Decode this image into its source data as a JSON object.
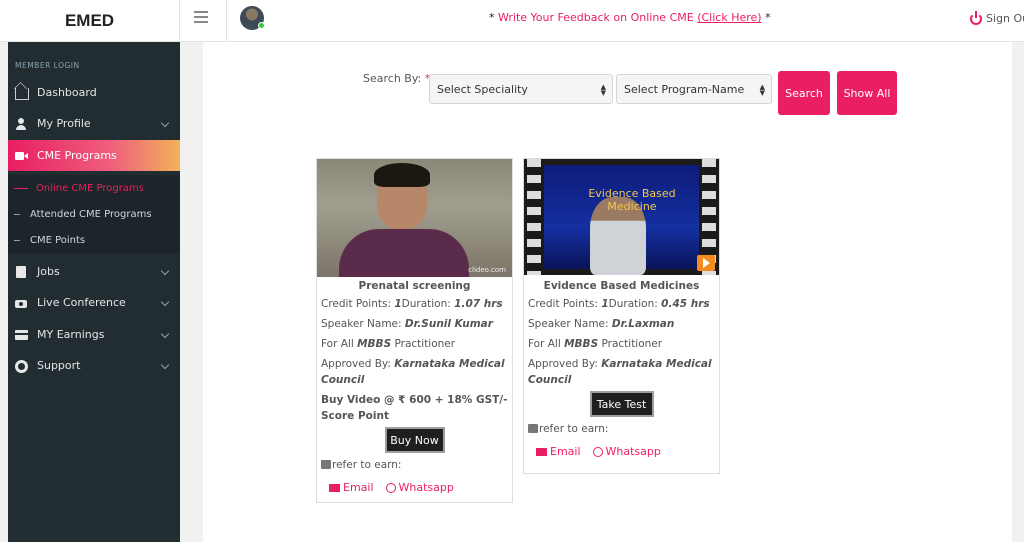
{
  "app": {
    "title": "EMED"
  },
  "topbar": {
    "feedback_prefix": "*",
    "feedback_text": "Write Your Feedback on Online CME",
    "feedback_link": "(Click Here)",
    "feedback_suffix": "*",
    "signout": "Sign Ou"
  },
  "sidebar": {
    "header": "MEMBER LOGIN",
    "items": [
      {
        "label": "Dashboard",
        "icon": "home-icon"
      },
      {
        "label": "My Profile",
        "icon": "user-icon"
      },
      {
        "label": "CME Programs",
        "icon": "video-icon"
      },
      {
        "label": "Jobs",
        "icon": "jobs-icon"
      },
      {
        "label": "Live Conference",
        "icon": "camera-icon"
      },
      {
        "label": "MY Earnings",
        "icon": "card-icon"
      },
      {
        "label": "Support",
        "icon": "support-icon"
      }
    ],
    "subitems": [
      {
        "label": "Online CME Programs"
      },
      {
        "label": "Attended CME Programs"
      },
      {
        "label": "CME Points"
      }
    ]
  },
  "search": {
    "label": "Search By:",
    "required_mark": "*",
    "speciality": "Select Speciality",
    "program": "Select Program-Name",
    "search_btn": "Search",
    "showall_btn": "Show All"
  },
  "cards": [
    {
      "title": "Prenatal screening",
      "credit_label": "Credit Points:",
      "credit": "1",
      "duration_label": "Duration:",
      "duration": "1.07 hrs",
      "speaker_label": "Speaker Name:",
      "speaker": "Dr.Sunil Kumar",
      "for_prefix": "For All",
      "for_degree": "MBBS",
      "for_suffix": "Practitioner",
      "approved_label": "Approved By:",
      "approved": "Karnataka Medical Council",
      "buy_text": "Buy Video @ ₹ 600 + 18% GST/- Score Point",
      "action": "Buy Now",
      "refer": "refer to earn:",
      "email": "Email",
      "whatsapp": "Whatsapp",
      "watermark": "clideo.com"
    },
    {
      "title": "Evidence Based Medicines",
      "credit_label": "Credit Points:",
      "credit": "1",
      "duration_label": "Duration:",
      "duration": "0.45 hrs",
      "speaker_label": "Speaker Name:",
      "speaker": "Dr.Laxman",
      "for_prefix": "For All",
      "for_degree": "MBBS",
      "for_suffix": "Practitioner",
      "approved_label": "Approved By:",
      "approved": "Karnataka Medical Council",
      "action": "Take Test",
      "refer": "refer to earn:",
      "email": "Email",
      "whatsapp": "Whatsapp",
      "thumb_text": "Evidence Based Medicine"
    }
  ],
  "colors": {
    "accent": "#e91e63",
    "sidebar_bg": "#222d32"
  }
}
